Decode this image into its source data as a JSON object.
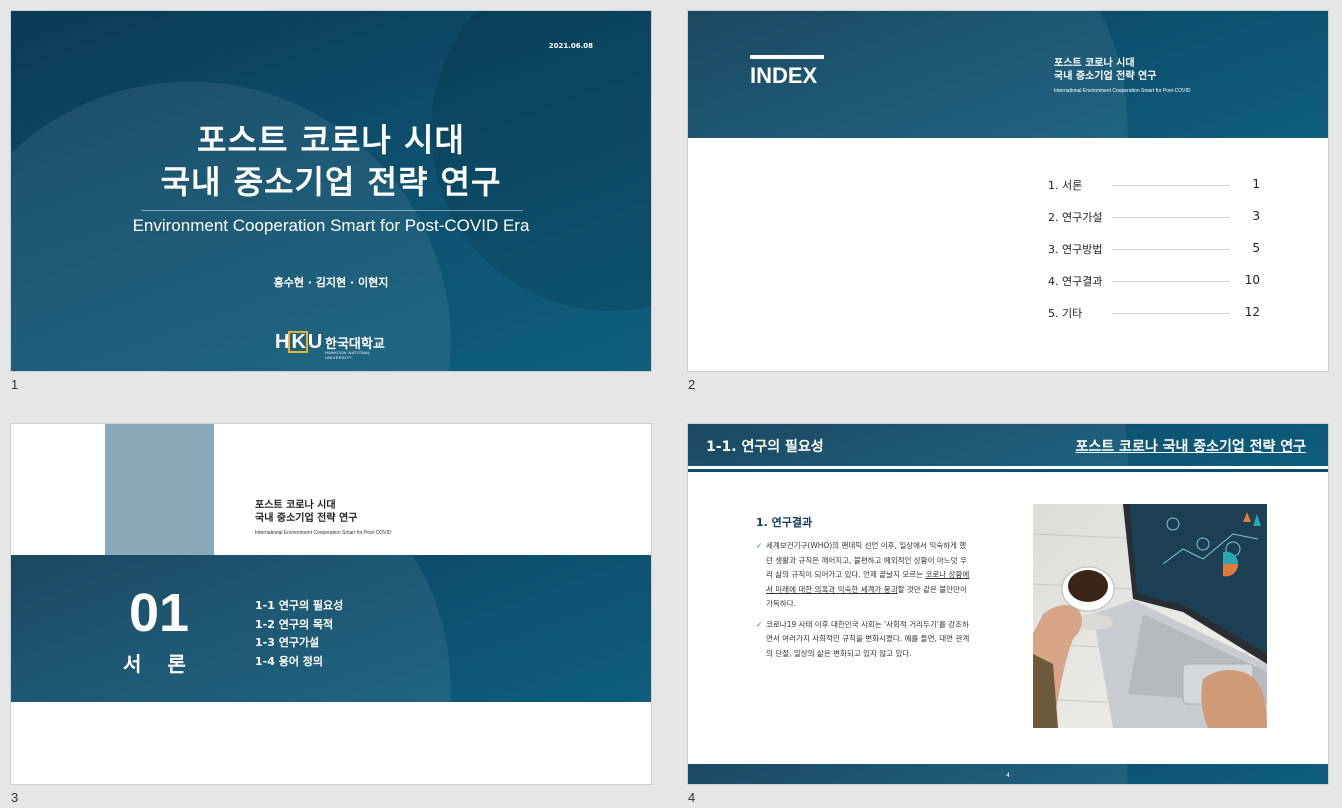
{
  "slide_numbers": [
    "1",
    "2",
    "3",
    "4"
  ],
  "slide1": {
    "date": "2021.06.08",
    "title_line1": "포스트 코로나 시대",
    "title_line2": "국내 중소기업 전략 연구",
    "subtitle": "Environment Cooperation Smart for Post-COVID Era",
    "authors": "홍수현 · 김지현 · 이현지",
    "logo_mark": "HKU",
    "logo_ko": "한국대학교",
    "logo_en": "HANKOOK NATIONAL UNIVERSITY"
  },
  "slide2": {
    "heading": "INDEX",
    "title_line1": "포스트 코로나 시대",
    "title_line2": "국내 중소기업 전략 연구",
    "subtitle": "International Environment Cooperation Smart for Post-COVID",
    "toc": [
      {
        "label": "1. 서론",
        "page": "1"
      },
      {
        "label": "2. 연구가설",
        "page": "3"
      },
      {
        "label": "3. 연구방법",
        "page": "5"
      },
      {
        "label": "4. 연구결과",
        "page": "10"
      },
      {
        "label": "5. 기타",
        "page": "12"
      }
    ]
  },
  "slide3": {
    "title_line1": "포스트 코로나 시대",
    "title_line2": "국내 중소기업 전략 연구",
    "subtitle": "International Environment Cooperation Smart for Post-COVID",
    "number": "01",
    "section": "서론",
    "items": [
      "1-1 연구의 필요성",
      "1-2 연구의 목적",
      "1-3 연구가설",
      "1-4 용어 정의"
    ]
  },
  "slide4": {
    "section_title": "1-1. 연구의 필요성",
    "deck_title": "포스트 코로나 국내 중소기업 전략 연구",
    "heading": "1. 연구결과",
    "bullet1_a": "세계보건기구(WHO)의 팬데믹 선언 이후, 일상에서 익숙하게 했던 생활과 규칙은 깨어지고, 불편하고 예외적인 상황이 아느덧 우리 삶의 규칙이 되어가고 있다. 언제 끝날지 모르는 ",
    "bullet1_u": "코로나 상황에서 미래에 대한 의혹과 익숙한 세계가 붕괴",
    "bullet1_b": "할 것만 같은 불안만이 가득하다.",
    "bullet2": "코로나19 사태 이후 대한민국 사회는 '사회적 거리두기'를 강조하면서 여러가지 사회적인 규칙을 변화시켰다. 예를 들면, 대면 관계의 단절, 일상의 삶은 변화되고 있지 않고 있다.",
    "page": "4",
    "check_icon": "✓"
  }
}
